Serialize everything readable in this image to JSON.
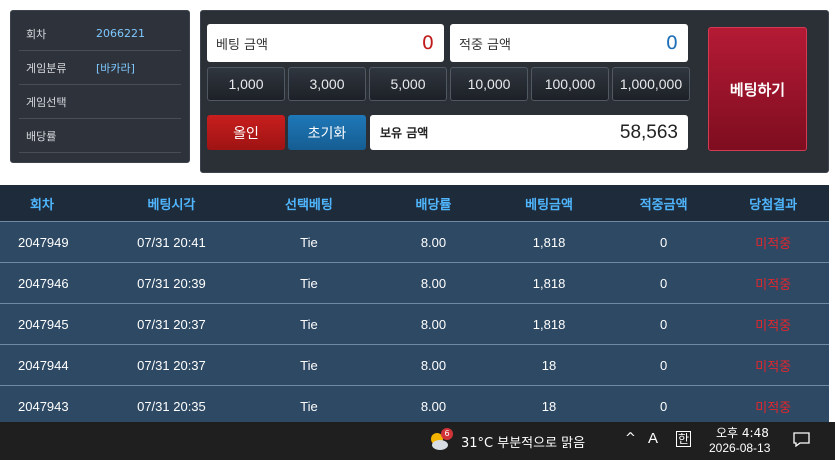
{
  "info": {
    "rows": [
      {
        "label": "회차",
        "value": "2066221"
      },
      {
        "label": "게임분류",
        "value": "[바카라]"
      },
      {
        "label": "게임선택",
        "value": ""
      },
      {
        "label": "배당률",
        "value": ""
      }
    ]
  },
  "bet": {
    "betting_label": "베팅 금액",
    "betting_value": "0",
    "hit_label": "적중 금액",
    "hit_value": "0",
    "chips": [
      "1,000",
      "3,000",
      "5,000",
      "10,000",
      "100,000",
      "1,000,000"
    ],
    "allin_label": "올인",
    "reset_label": "초기화",
    "balance_label": "보유 금액",
    "balance_value": "58,563",
    "bet_button_label": "베팅하기"
  },
  "colors": {
    "betting_value": "#c01b1b",
    "hit_value": "#1f6fb8",
    "header_text": "#4fb6ff",
    "result_text": "#e3262d"
  },
  "table": {
    "headers": [
      "회차",
      "베팅시각",
      "선택베팅",
      "배당률",
      "베팅금액",
      "적중금액",
      "당첨결과"
    ],
    "rows": [
      [
        "2047949",
        "07/31 20:41",
        "Tie",
        "8.00",
        "1,818",
        "0",
        "미적중"
      ],
      [
        "2047946",
        "07/31 20:39",
        "Tie",
        "8.00",
        "1,818",
        "0",
        "미적중"
      ],
      [
        "2047945",
        "07/31 20:37",
        "Tie",
        "8.00",
        "1,818",
        "0",
        "미적중"
      ],
      [
        "2047944",
        "07/31 20:37",
        "Tie",
        "8.00",
        "18",
        "0",
        "미적중"
      ],
      [
        "2047943",
        "07/31 20:35",
        "Tie",
        "8.00",
        "18",
        "0",
        "미적중"
      ]
    ]
  },
  "taskbar": {
    "weather_badge": "6",
    "weather_text": "31°C  부분적으로 맑음",
    "tray_up": "^",
    "tray_a": "A",
    "ime": "한",
    "time": "오후 4:48",
    "date": "2026-08-13",
    "icons": [
      "weather-icon",
      "chevron-up-icon",
      "ime-icon",
      "notification-icon"
    ]
  }
}
